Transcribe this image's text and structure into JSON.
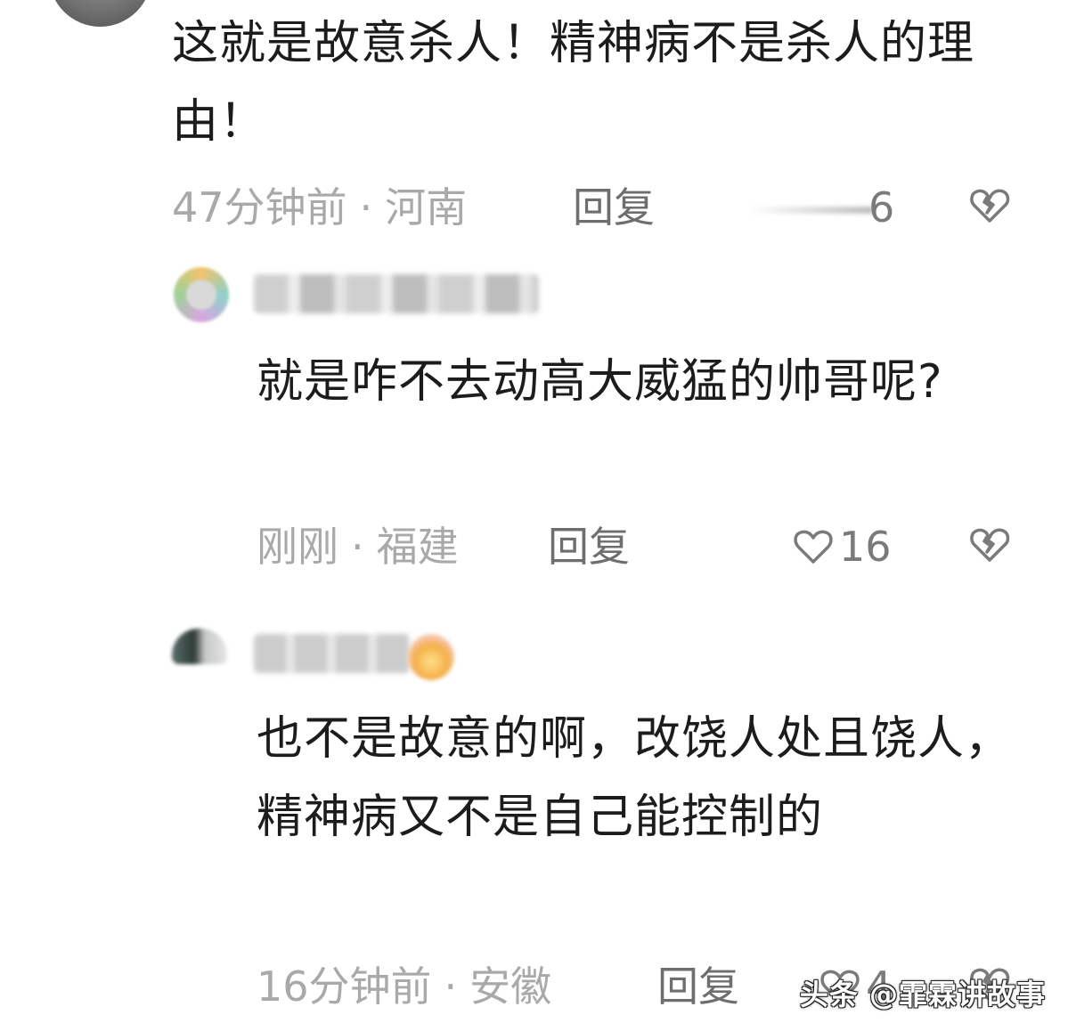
{
  "comments": [
    {
      "text": "这就是故意杀人！精神病不是杀人的理由！",
      "time": "47分钟前",
      "location": "河南",
      "reply_label": "回复",
      "likes": "6"
    },
    {
      "text": "就是咋不去动高大威猛的帅哥呢?",
      "time": "刚刚",
      "location": "福建",
      "reply_label": "回复",
      "likes": "16"
    },
    {
      "text": "也不是故意的啊，改饶人处且饶人，精神病又不是自己能控制的",
      "time": "16分钟前",
      "location": "安徽",
      "reply_label": "回复",
      "likes": "4"
    }
  ],
  "separator": "·",
  "watermark": "头条 @霏霖讲故事",
  "colors": {
    "text": "#1c1c1c",
    "meta": "#a9a9a9",
    "reply": "#6e6e6e",
    "background": "#ffffff"
  },
  "icons": {
    "like": "heart-outline-icon",
    "dislike": "broken-heart-icon"
  }
}
